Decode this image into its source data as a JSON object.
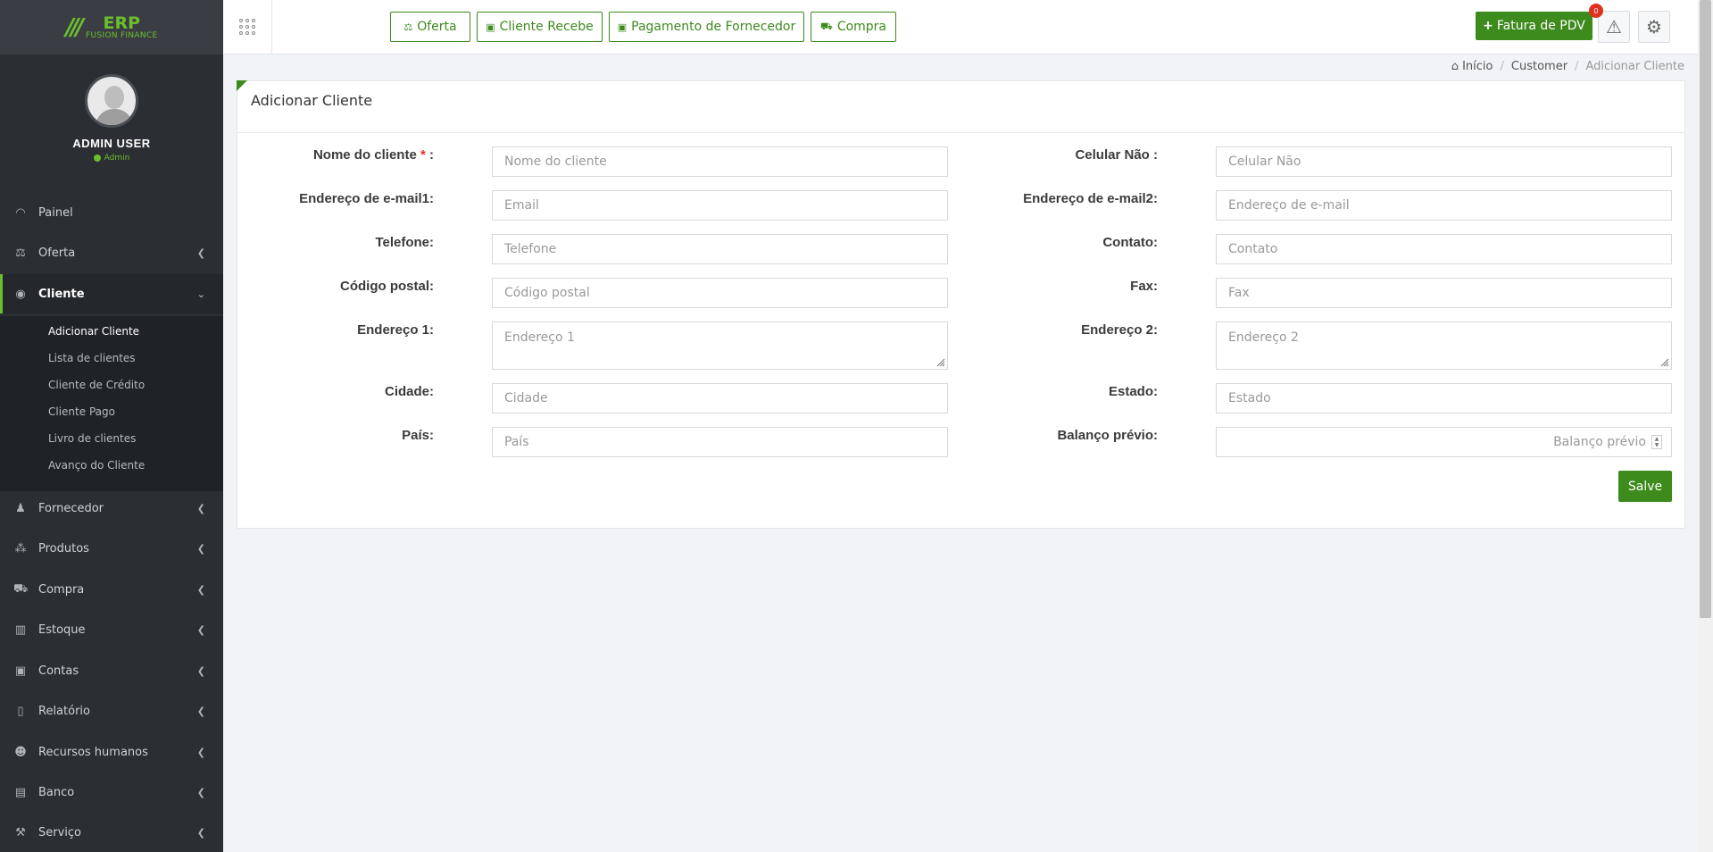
{
  "logo": {
    "erp": "ERP",
    "tagline": "FUSION FINANCE"
  },
  "profile": {
    "name": "ADMIN USER",
    "role": "Admin"
  },
  "sidebar": {
    "items": [
      {
        "label": "Painel"
      },
      {
        "label": "Oferta"
      },
      {
        "label": "Cliente"
      },
      {
        "label": "Fornecedor"
      },
      {
        "label": "Produtos"
      },
      {
        "label": "Compra"
      },
      {
        "label": "Estoque"
      },
      {
        "label": "Contas"
      },
      {
        "label": "Relatório"
      },
      {
        "label": "Recursos humanos"
      },
      {
        "label": "Banco"
      },
      {
        "label": "Serviço"
      }
    ],
    "submenu": [
      {
        "label": "Adicionar Cliente"
      },
      {
        "label": "Lista de clientes"
      },
      {
        "label": "Cliente de Crédito"
      },
      {
        "label": "Cliente Pago"
      },
      {
        "label": "Livro de clientes"
      },
      {
        "label": "Avanço do Cliente"
      }
    ]
  },
  "topbar": {
    "buttons": [
      {
        "label": "Oferta"
      },
      {
        "label": "Cliente Recebe"
      },
      {
        "label": "Pagamento de Fornecedor"
      },
      {
        "label": "Compra"
      }
    ],
    "pdv_label": "Fatura de PDV",
    "notification_count": "0"
  },
  "breadcrumb": {
    "home": "Início",
    "section": "Customer",
    "current": "Adicionar Cliente"
  },
  "form": {
    "title": "Adicionar Cliente",
    "required_mark": "*",
    "left": [
      {
        "label": "Nome do cliente",
        "suffix": ":",
        "placeholder": "Nome do cliente"
      },
      {
        "label": "Endereço de e-mail1:",
        "placeholder": "Email"
      },
      {
        "label": "Telefone:",
        "placeholder": "Telefone"
      },
      {
        "label": "Código postal:",
        "placeholder": "Código postal"
      },
      {
        "label": "Endereço 1:",
        "placeholder": "Endereço 1"
      },
      {
        "label": "Cidade:",
        "placeholder": "Cidade"
      },
      {
        "label": "País:",
        "placeholder": "País"
      }
    ],
    "right": [
      {
        "label": "Celular Não :",
        "placeholder": "Celular Não"
      },
      {
        "label": "Endereço de e-mail2:",
        "placeholder": "Endereço de e-mail"
      },
      {
        "label": "Contato:",
        "placeholder": "Contato"
      },
      {
        "label": "Fax:",
        "placeholder": "Fax"
      },
      {
        "label": "Endereço 2:",
        "placeholder": "Endereço 2"
      },
      {
        "label": "Estado:",
        "placeholder": "Estado"
      },
      {
        "label": "Balanço prévio:",
        "placeholder": "Balanço prévio"
      }
    ],
    "save_label": "Salve"
  },
  "colors": {
    "accent": "#3d8a1d",
    "sidebar": "#2b2e33",
    "badge": "#e0301e"
  }
}
